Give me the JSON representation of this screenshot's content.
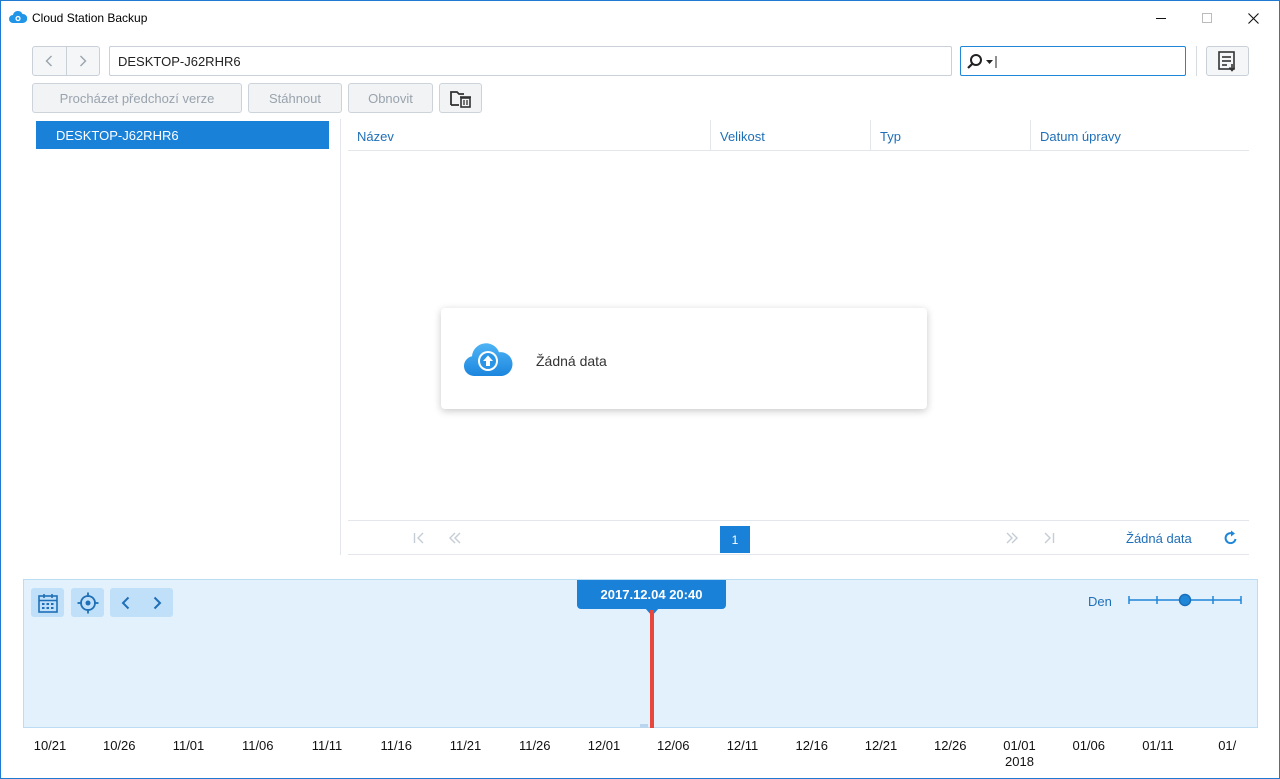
{
  "window": {
    "title": "Cloud Station Backup",
    "accent": "#1a81d8"
  },
  "toolbar": {
    "path": "DESKTOP-J62RHR6",
    "search_value": "",
    "browse_label": "Procházet předchozí verze",
    "download_label": "Stáhnout",
    "restore_label": "Obnovit"
  },
  "tree": {
    "items": [
      {
        "label": "DESKTOP-J62RHR6",
        "selected": true
      }
    ]
  },
  "grid": {
    "columns": [
      "Název",
      "Velikost",
      "Typ",
      "Datum úpravy"
    ],
    "rows": []
  },
  "pager": {
    "current_page": "1",
    "status": "Žádná data"
  },
  "empty_state": {
    "message": "Žádná data"
  },
  "timeline": {
    "selected": "2017.12.04 20:40",
    "zoom_label": "Den",
    "zoom_level": 3,
    "zoom_steps": 5,
    "ticks": [
      "10/21",
      "10/26",
      "11/01",
      "11/06",
      "11/11",
      "11/16",
      "11/21",
      "11/26",
      "12/01",
      "12/06",
      "12/11",
      "12/16",
      "12/21",
      "12/26",
      "01/01",
      "01/06",
      "01/11",
      "01/"
    ],
    "year_label": "2018"
  }
}
